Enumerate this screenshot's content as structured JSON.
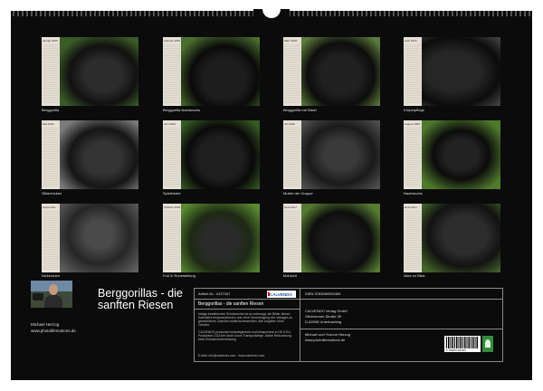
{
  "months": [
    {
      "name": "Januar 2025",
      "caption": "Berggorilla"
    },
    {
      "name": "Februar 2025",
      "caption": "Berggorilla-Nachwuchs"
    },
    {
      "name": "März 2025",
      "caption": "Berggorilla mit Distel"
    },
    {
      "name": "April 2025",
      "caption": "Körperpflege"
    },
    {
      "name": "Mai 2025",
      "caption": "Silberrücken"
    },
    {
      "name": "Juni 2025",
      "caption": "Spielkinder"
    },
    {
      "name": "Juli 2025",
      "caption": "Mutter der Gruppe"
    },
    {
      "name": "August 2025",
      "caption": "Nachwuchs"
    },
    {
      "name": "September 2025",
      "caption": "Nickerchen"
    },
    {
      "name": "Oktober 2025",
      "caption": "Fuß in Ruhestellung"
    },
    {
      "name": "November 2025",
      "caption": "Mahlzeit"
    },
    {
      "name": "Dezember 2025",
      "caption": "Alles im Blick"
    }
  ],
  "cover": {
    "title": "Berggorillas - die sanften Riesen",
    "author": "Michael Herzog",
    "website": "www.photolifemotions.de"
  },
  "info": {
    "article_label": "Artikel-Nr.: 2437267",
    "brand": "CALVENDO",
    "subtitle": "Berggorillas - die sanften Riesen",
    "para1": "Infolge bestehender Schutzrechte ist es untersagt, die Bilder dieses Kalenders herauszutrennen und ohne Genehmigung des Verlages zu gewerblichen Zwecken weiterzuverwenden. Alle Angaben ohne Gewähr.",
    "para2": "CALVENDO produziert bedarfsgerecht und klimaneutral in DE & EU. Produktion CO2-frei durch kurze Transportwege. Aktive Reduzierung beim Emissionsvermeidung.",
    "email": "E-Mail: info@calvendo.com · www.calvendo.com",
    "isbn": "ISBN 9783669930469",
    "publisher": "CALVENDO Verlag GmbH",
    "street": "Ottobrunner Straße 39",
    "city": "D-82008 Unterhaching",
    "credit": "Michael und Yvonne Herzog",
    "credit_url": "www.photolifemotions.de",
    "barcode_number": "9 783669 930469"
  }
}
